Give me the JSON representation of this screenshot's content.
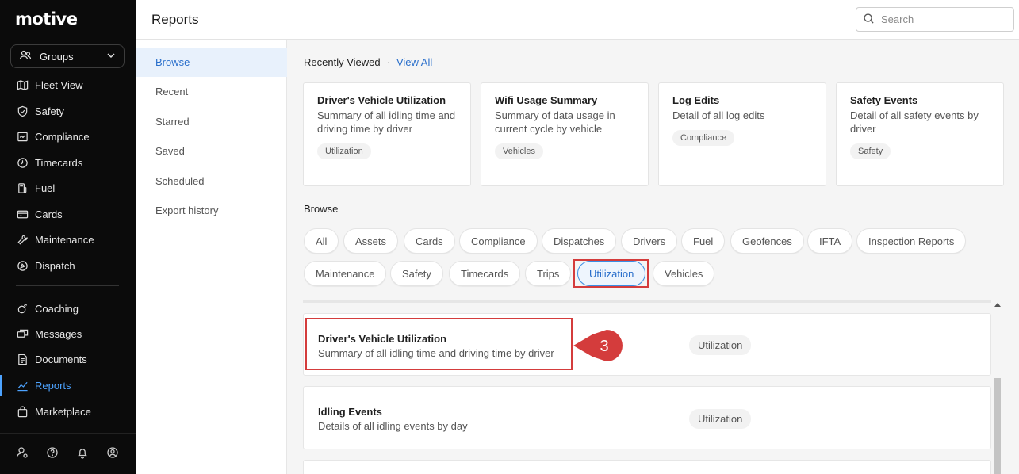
{
  "brand": {
    "logo_text": "motive"
  },
  "sidebar": {
    "groups_label": "Groups",
    "items": [
      {
        "label": "Fleet View",
        "icon": "map-icon"
      },
      {
        "label": "Safety",
        "icon": "shield-icon"
      },
      {
        "label": "Compliance",
        "icon": "compliance-icon"
      },
      {
        "label": "Timecards",
        "icon": "clock-icon"
      },
      {
        "label": "Fuel",
        "icon": "fuel-icon"
      },
      {
        "label": "Cards",
        "icon": "card-icon"
      },
      {
        "label": "Maintenance",
        "icon": "wrench-icon"
      },
      {
        "label": "Dispatch",
        "icon": "dispatch-icon"
      },
      {
        "label": "Coaching",
        "icon": "coaching-icon"
      },
      {
        "label": "Messages",
        "icon": "messages-icon"
      },
      {
        "label": "Documents",
        "icon": "document-icon"
      },
      {
        "label": "Reports",
        "icon": "reports-icon",
        "active": true
      },
      {
        "label": "Marketplace",
        "icon": "bag-icon"
      }
    ],
    "bottom_icons": [
      "user-settings-icon",
      "help-icon",
      "bell-icon",
      "account-icon"
    ]
  },
  "header": {
    "title": "Reports",
    "search_placeholder": "Search"
  },
  "subnav": {
    "items": [
      {
        "label": "Browse",
        "active": true
      },
      {
        "label": "Recent"
      },
      {
        "label": "Starred"
      },
      {
        "label": "Saved"
      },
      {
        "label": "Scheduled"
      },
      {
        "label": "Export history"
      }
    ]
  },
  "recently_viewed": {
    "heading": "Recently Viewed",
    "separator": "·",
    "view_all": "View All",
    "cards": [
      {
        "title": "Driver's Vehicle Utilization",
        "desc": "Summary of all idling time and driving time by driver",
        "tag": "Utilization"
      },
      {
        "title": "Wifi Usage Summary",
        "desc": "Summary of data usage in current cycle by vehicle",
        "tag": "Vehicles"
      },
      {
        "title": "Log Edits",
        "desc": "Detail of all log edits",
        "tag": "Compliance"
      },
      {
        "title": "Safety Events",
        "desc": "Detail of all safety events by driver",
        "tag": "Safety"
      }
    ]
  },
  "browse": {
    "heading": "Browse",
    "categories": [
      "All",
      "Assets",
      "Cards",
      "Compliance",
      "Dispatches",
      "Drivers",
      "Fuel",
      "Geofences",
      "IFTA",
      "Inspection Reports",
      "Maintenance",
      "Safety",
      "Timecards",
      "Trips",
      "Utilization",
      "Vehicles"
    ],
    "selected": "Utilization"
  },
  "reports": [
    {
      "title": "Driver's Vehicle Utilization",
      "desc": "Summary of all idling time and driving time by driver",
      "tag": "Utilization"
    },
    {
      "title": "Idling Events",
      "desc": "Details of all idling events by day",
      "tag": "Utilization"
    }
  ],
  "annotation": {
    "step_number": "3",
    "color": "#d43c3c"
  },
  "colors": {
    "accent": "#2a6fcb",
    "sidebar_bg": "#0b0b0b",
    "highlight": "#d43c3c"
  }
}
